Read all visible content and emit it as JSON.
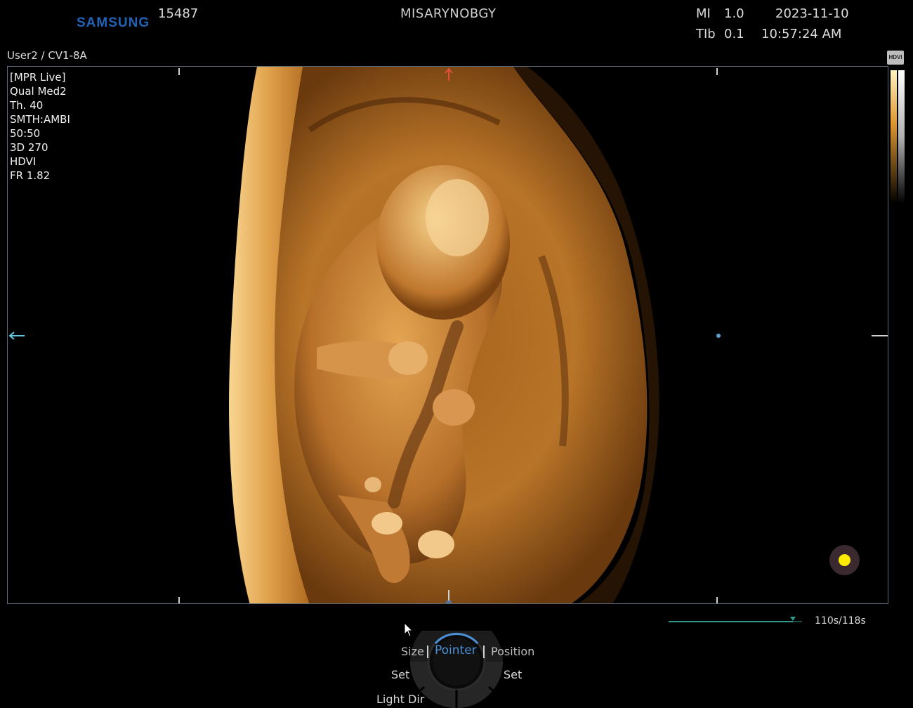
{
  "header": {
    "brand": "SAMSUNG",
    "patient_id": "15487",
    "institution": "MISARYNOBGY",
    "mi_label": "MI",
    "mi_value": "1.0",
    "tib_label": "TIb",
    "tib_value": "0.1",
    "date": "2023-11-10",
    "time": "10:57:24 AM"
  },
  "probe": "User2 / CV1-8A",
  "params": [
    "[MPR Live]",
    "Qual Med2",
    "Th. 40",
    "SMTH:AMBI",
    "50:50",
    "3D 270",
    "HDVI",
    "FR 1.82"
  ],
  "hdvi_badge": "HDVI",
  "cine": {
    "text": "110s/118s",
    "progress": 0.932,
    "color": "#2e9a8a"
  },
  "controls": {
    "size": "Size",
    "pointer": "Pointer",
    "position": "Position",
    "set_left": "Set",
    "set_right": "Set",
    "light_dir": "Light Dir"
  },
  "colors": {
    "accent_blue": "#4a90d9",
    "brand_blue": "#1f63b6",
    "indicator_yellow": "#ffeb00",
    "tissue": "#c8842a"
  }
}
